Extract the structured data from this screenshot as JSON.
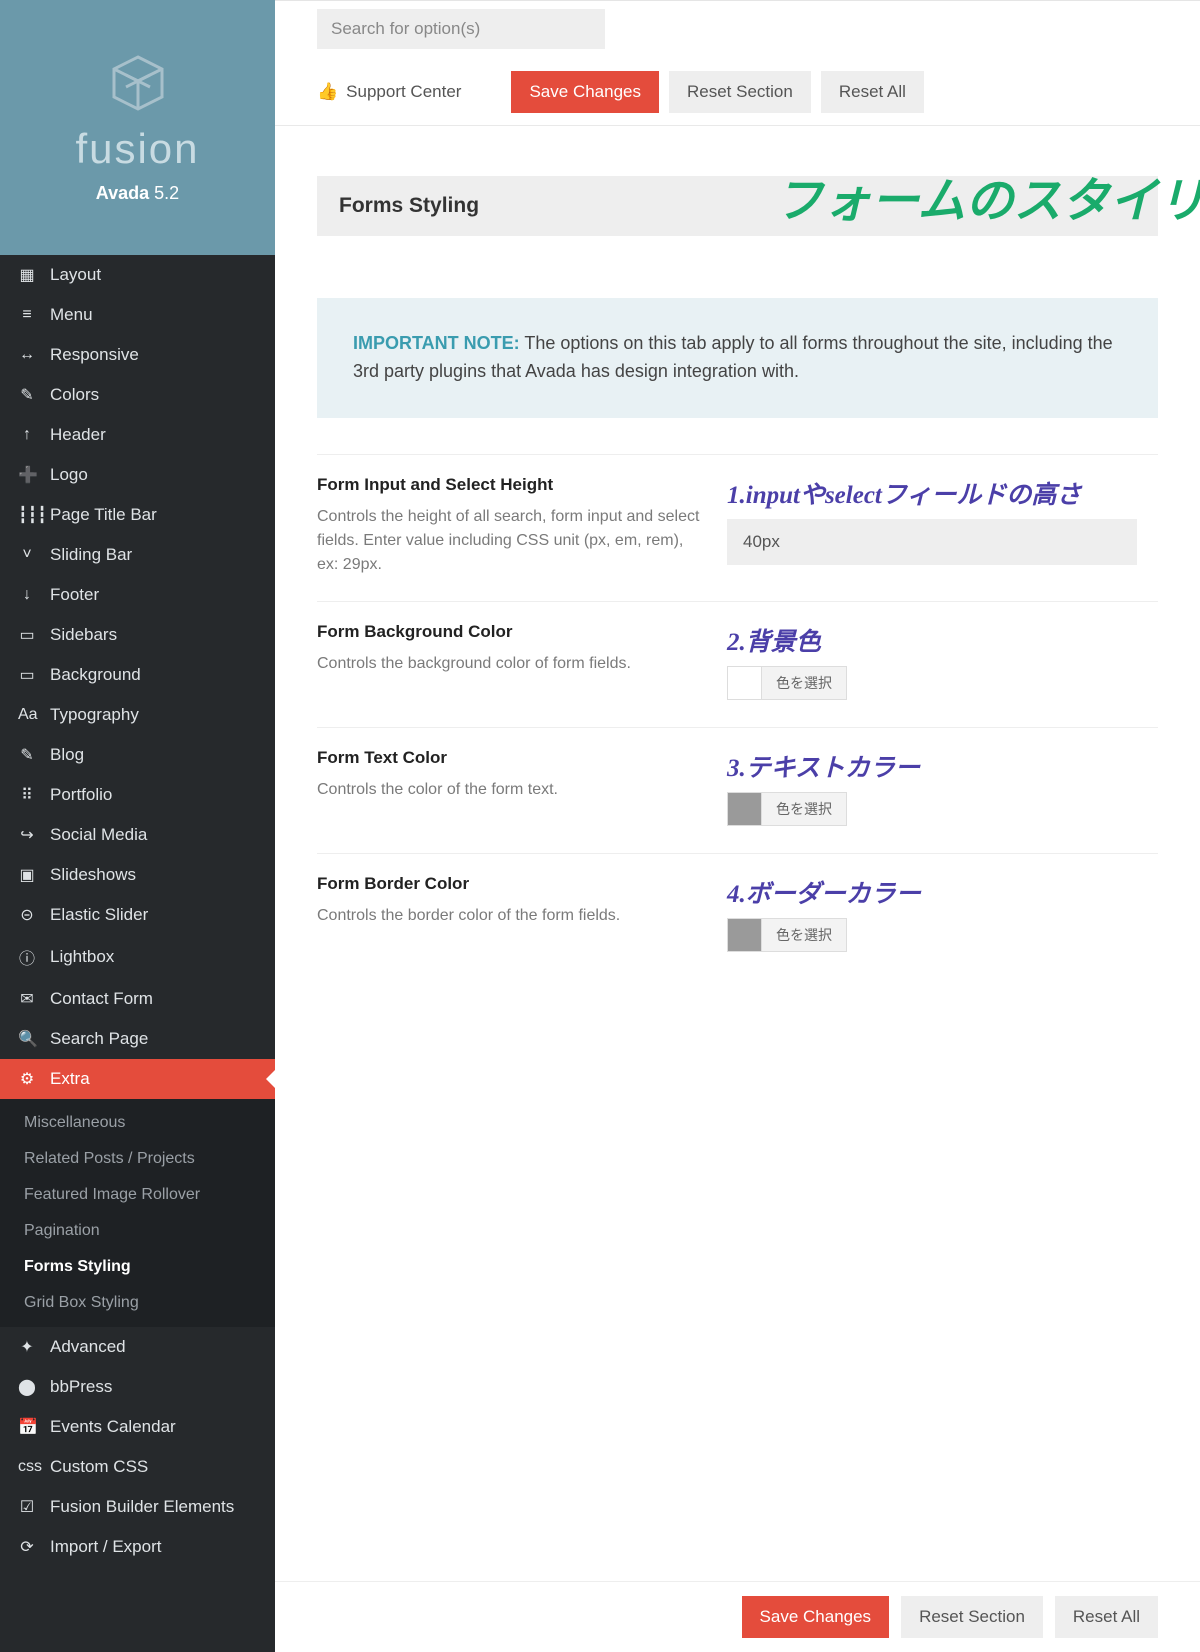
{
  "brand": {
    "name": "fusion",
    "product": "Avada",
    "version": "5.2"
  },
  "topbar": {
    "search_placeholder": "Search for option(s)",
    "support": "Support Center",
    "save": "Save Changes",
    "reset_section": "Reset Section",
    "reset_all": "Reset All"
  },
  "section": {
    "title": "Forms Styling",
    "jp_title": "フォームのスタイリング"
  },
  "note": {
    "label": "IMPORTANT NOTE:",
    "text": " The options on this tab apply to all forms throughout the site, including the 3rd party plugins that Avada has design integration with."
  },
  "options": {
    "height": {
      "title": "Form Input and Select Height",
      "desc": "Controls the height of all search, form input and select fields. Enter value including CSS unit (px, em, rem), ex: 29px.",
      "value": "40px",
      "ann": "1.inputやselectフィールドの高さ"
    },
    "bg": {
      "title": "Form Background Color",
      "desc": "Controls the background color of form fields.",
      "ann": "2.背景色",
      "pick": "色を選択"
    },
    "text": {
      "title": "Form Text Color",
      "desc": "Controls the color of the form text.",
      "ann": "3.テキストカラー",
      "pick": "色を選択"
    },
    "border": {
      "title": "Form Border Color",
      "desc": "Controls the border color of the form fields.",
      "ann": "4.ボーダーカラー",
      "pick": "色を選択"
    }
  },
  "nav": [
    {
      "icon": "▦",
      "label": "Layout"
    },
    {
      "icon": "≡",
      "label": "Menu"
    },
    {
      "icon": "↔",
      "label": "Responsive"
    },
    {
      "icon": "✎",
      "label": "Colors"
    },
    {
      "icon": "↑",
      "label": "Header"
    },
    {
      "icon": "➕",
      "label": "Logo"
    },
    {
      "icon": "┇┇┇",
      "label": "Page Title Bar"
    },
    {
      "icon": "˅",
      "label": "Sliding Bar"
    },
    {
      "icon": "↓",
      "label": "Footer"
    },
    {
      "icon": "▭",
      "label": "Sidebars"
    },
    {
      "icon": "▭",
      "label": "Background"
    },
    {
      "icon": "Aa",
      "label": "Typography"
    },
    {
      "icon": "✎",
      "label": "Blog"
    },
    {
      "icon": "⠿",
      "label": "Portfolio"
    },
    {
      "icon": "↪",
      "label": "Social Media"
    },
    {
      "icon": "▣",
      "label": "Slideshows"
    },
    {
      "icon": "⊝",
      "label": "Elastic Slider"
    },
    {
      "icon": "ⓘ",
      "label": "Lightbox"
    },
    {
      "icon": "✉",
      "label": "Contact Form"
    },
    {
      "icon": "🔍",
      "label": "Search Page"
    }
  ],
  "nav_extra": {
    "icon": "⚙",
    "label": "Extra"
  },
  "subnav": [
    "Miscellaneous",
    "Related Posts / Projects",
    "Featured Image Rollover",
    "Pagination",
    "Forms Styling",
    "Grid Box Styling"
  ],
  "nav_after": [
    {
      "icon": "✦",
      "label": "Advanced"
    },
    {
      "icon": "⬤",
      "label": "bbPress"
    },
    {
      "icon": "📅",
      "label": "Events Calendar"
    },
    {
      "icon": "css",
      "label": "Custom CSS"
    },
    {
      "icon": "☑",
      "label": "Fusion Builder Elements"
    },
    {
      "icon": "⟳",
      "label": "Import / Export"
    }
  ]
}
